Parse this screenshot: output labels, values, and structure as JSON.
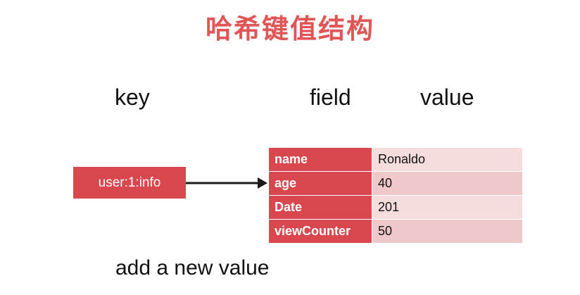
{
  "title": "哈希键值结构",
  "labels": {
    "key": "key",
    "field": "field",
    "value": "value"
  },
  "key_name": "user:1:info",
  "hash": {
    "rows": [
      {
        "field": "name",
        "value": "Ronaldo"
      },
      {
        "field": "age",
        "value": "40"
      },
      {
        "field": "Date",
        "value": "201"
      },
      {
        "field": "viewCounter",
        "value": "50"
      }
    ]
  },
  "caption": "add a new value",
  "colors": {
    "title": "#e05555",
    "field_cell": "#d9474e",
    "value_cell": "#f6dcdc",
    "value_cell_alt": "#efc9ca"
  }
}
